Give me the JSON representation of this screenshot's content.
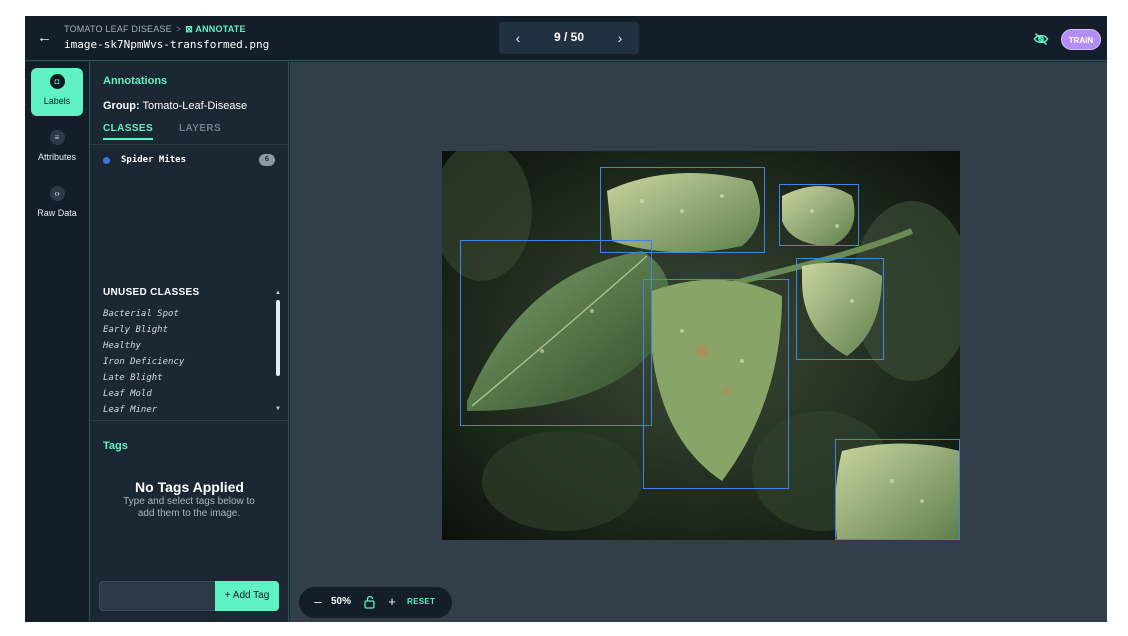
{
  "header": {
    "back_icon": "arrow-left-icon",
    "breadcrumb_project": "TOMATO LEAF DISEASE",
    "breadcrumb_separator": ">",
    "breadcrumb_active": "ANNOTATE",
    "filename": "image-sk7NpmWvs-transformed.png",
    "pager": {
      "current": "9 / 50"
    },
    "train_label": "TRAIN",
    "accent": "#5ff2c2",
    "train_color": "#b38cf5"
  },
  "rail": {
    "items": [
      {
        "label": "Labels",
        "icon": "tag-icon",
        "active": true
      },
      {
        "label": "Attributes",
        "icon": "list-icon",
        "active": false
      },
      {
        "label": "Raw Data",
        "icon": "code-icon",
        "active": false
      }
    ]
  },
  "panel": {
    "title": "Annotations",
    "group_label": "Group:",
    "group_value": "Tomato-Leaf-Disease",
    "tabs": [
      "CLASSES",
      "LAYERS"
    ],
    "classes": [
      {
        "name": "Spider Mites",
        "count": "6",
        "color": "#3d73e0"
      }
    ],
    "unused_title": "UNUSED CLASSES",
    "unused": [
      "Bacterial Spot",
      "Early Blight",
      "Healthy",
      "Iron Deficiency",
      "Late Blight",
      "Leaf Mold",
      "Leaf Miner"
    ],
    "tags_title": "Tags",
    "no_tags_title": "No Tags Applied",
    "no_tags_sub": "Type and select tags below to add them to the image.",
    "tag_input_value": "",
    "add_tag_label": "+ Add Tag"
  },
  "zoom": {
    "minus": "–",
    "value": "50%",
    "plus": "+",
    "reset": "RESET"
  },
  "annotations_color": "#3d85e6"
}
